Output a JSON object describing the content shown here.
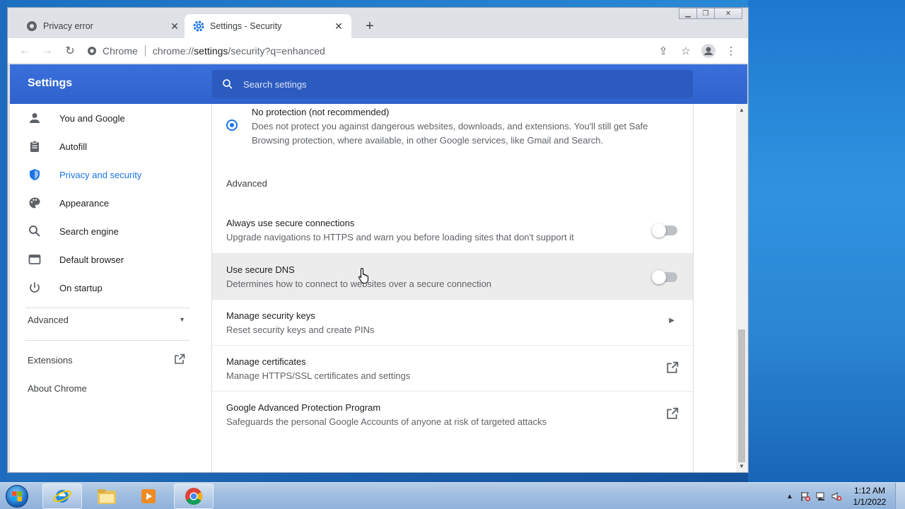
{
  "browser": {
    "tabs": [
      {
        "title": "Privacy error",
        "active": false,
        "icon": "warning-icon"
      },
      {
        "title": "Settings - Security",
        "active": true,
        "icon": "gear-icon"
      }
    ],
    "omnibox": {
      "site_label": "Chrome",
      "url_prefix": "chrome://",
      "url_host": "settings",
      "url_rest": "/security?q=enhanced"
    }
  },
  "settings": {
    "header_title": "Settings",
    "search_placeholder": "Search settings",
    "accent": "#1a73e8",
    "header_color": "#3367d6",
    "sidebar": {
      "items": [
        {
          "label": "You and Google",
          "icon": "person-icon"
        },
        {
          "label": "Autofill",
          "icon": "clipboard-icon"
        },
        {
          "label": "Privacy and security",
          "icon": "shield-icon",
          "selected": true
        },
        {
          "label": "Appearance",
          "icon": "palette-icon"
        },
        {
          "label": "Search engine",
          "icon": "search-icon"
        },
        {
          "label": "Default browser",
          "icon": "browser-icon"
        },
        {
          "label": "On startup",
          "icon": "power-icon"
        }
      ],
      "advanced_label": "Advanced",
      "extensions_label": "Extensions",
      "about_label": "About Chrome"
    },
    "security": {
      "no_protection_title": "No protection (not recommended)",
      "no_protection_desc": "Does not protect you against dangerous websites, downloads, and extensions. You'll still get Safe Browsing protection, where available, in other Google services, like Gmail and Search.",
      "advanced_heading": "Advanced",
      "rows": [
        {
          "title": "Always use secure connections",
          "desc": "Upgrade navigations to HTTPS and warn you before loading sites that don't support it",
          "control": "toggle",
          "on": false
        },
        {
          "title": "Use secure DNS",
          "desc": "Determines how to connect to websites over a secure connection",
          "control": "toggle",
          "on": false
        },
        {
          "title": "Manage security keys",
          "desc": "Reset security keys and create PINs",
          "control": "arrow"
        },
        {
          "title": "Manage certificates",
          "desc": "Manage HTTPS/SSL certificates and settings",
          "control": "external-link"
        },
        {
          "title": "Google Advanced Protection Program",
          "desc": "Safeguards the personal Google Accounts of anyone at risk of targeted attacks",
          "control": "external-link"
        }
      ]
    }
  },
  "taskbar": {
    "apps": [
      "internet-explorer-icon",
      "file-explorer-icon",
      "media-player-icon",
      "chrome-icon"
    ],
    "clock_time": "1:12 AM",
    "clock_date": "1/1/2022"
  }
}
